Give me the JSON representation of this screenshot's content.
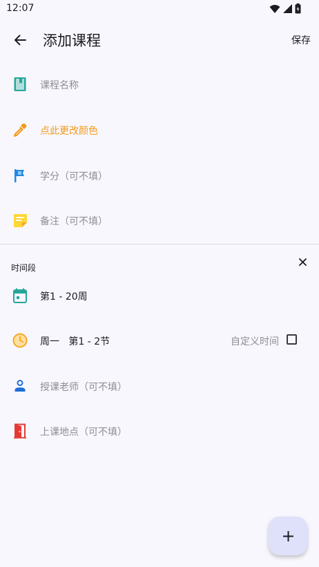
{
  "status_bar": {
    "time": "12:07"
  },
  "app_bar": {
    "title": "添加课程",
    "save_label": "保存"
  },
  "form": {
    "course_name_placeholder": "课程名称",
    "color_label": "点此更改颜色",
    "credit_placeholder": "学分（可不填）",
    "note_placeholder": "备注（可不填）"
  },
  "time_section": {
    "title": "时间段",
    "weeks": "第1 - 20周",
    "weekday": "周一",
    "periods": "第1 - 2节",
    "custom_time_label": "自定义时间",
    "custom_time_checked": false,
    "teacher_placeholder": "授课老师（可不填）",
    "location_placeholder": "上课地点（可不填）"
  },
  "colors": {
    "book_icon": "#26a69a",
    "accent_orange": "#f29a1a",
    "flag_icon": "#1e88e5",
    "note_icon": "#fdd835",
    "calendar_icon": "#26a69a",
    "clock_icon": "#f9a825",
    "person_icon": "#1e6fd9",
    "door_icon": "#e53935",
    "fab_bg": "#dfe1fb"
  },
  "icons": [
    "back-arrow-icon",
    "book-icon",
    "eyedropper-icon",
    "flag-icon",
    "note-icon",
    "close-icon",
    "calendar-icon",
    "clock-icon",
    "person-icon",
    "door-icon",
    "plus-icon"
  ]
}
